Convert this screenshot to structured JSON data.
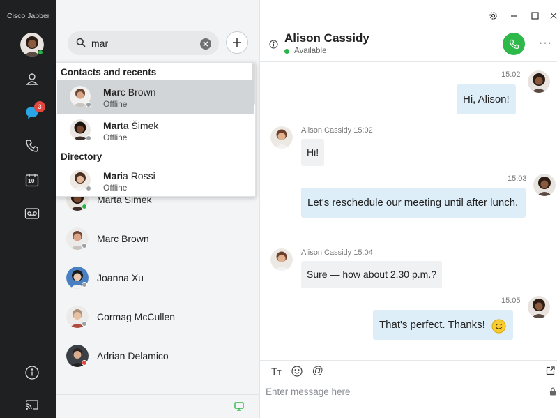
{
  "app": {
    "title": "Cisco Jabber"
  },
  "rail": {
    "chat_badge": "3",
    "calendar_day": "10"
  },
  "search": {
    "value": "mar"
  },
  "dropdown": {
    "section_contacts": "Contacts and recents",
    "section_directory": "Directory",
    "results": [
      {
        "match": "Mar",
        "rest": "c Brown",
        "status": "Offline"
      },
      {
        "match": "Mar",
        "rest": "ta Šimek",
        "status": "Offline"
      },
      {
        "match": "Mar",
        "rest": "ia Rossi",
        "status": "Offline"
      }
    ]
  },
  "contacts": [
    {
      "name": "Marta Šimek",
      "presence_color": "#28b446"
    },
    {
      "name": "Marc Brown",
      "presence_color": "#9aa0a5"
    },
    {
      "name": "Joanna Xu",
      "presence_color": "#9aa0a5"
    },
    {
      "name": "Cormag McCullen",
      "presence_color": "#9aa0a5"
    },
    {
      "name": "Adrian Delamico",
      "presence_color": "#e2463d"
    }
  ],
  "chat": {
    "name": "Alison Cassidy",
    "status": "Available",
    "messages": [
      {
        "direction": "out",
        "time": "15:02",
        "text": "Hi, Alison!"
      },
      {
        "direction": "in",
        "sender": "Alison Cassidy 15:02",
        "text": "Hi!"
      },
      {
        "direction": "out",
        "time": "15:03",
        "text": "Let's reschedule our meeting until after lunch."
      },
      {
        "direction": "in",
        "sender": "Alison Cassidy 15:04",
        "text": "Sure — how about 2.30 p.m.?"
      },
      {
        "direction": "out",
        "time": "15:05",
        "text": "That's perfect. Thanks!"
      }
    ],
    "compose_placeholder": "Enter message here"
  },
  "colors": {
    "accent_green": "#2db84a",
    "rail_bg": "#1e2022",
    "bubble_out": "#ddeef9",
    "badge_red": "#e2463d"
  }
}
